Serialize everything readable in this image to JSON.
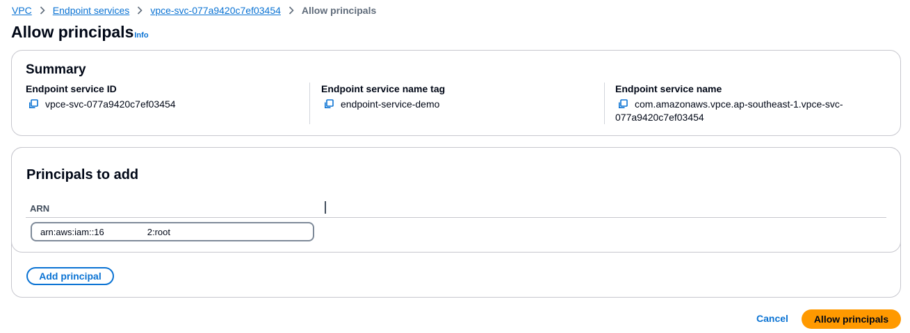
{
  "breadcrumb": {
    "items": [
      "VPC",
      "Endpoint services",
      "vpce-svc-077a9420c7ef03454"
    ],
    "current": "Allow principals"
  },
  "page": {
    "title": "Allow principals",
    "info_label": "Info"
  },
  "summary": {
    "title": "Summary",
    "columns": [
      {
        "label": "Endpoint service ID",
        "value": "vpce-svc-077a9420c7ef03454"
      },
      {
        "label": "Endpoint service name tag",
        "value": "endpoint-service-demo"
      },
      {
        "label": "Endpoint service name",
        "value_line1": "com.amazonaws.vpce.ap-southeast-1.vpce-svc-",
        "value_line2": "077a9420c7ef03454"
      }
    ]
  },
  "principals": {
    "title": "Principals to add",
    "column_header": "ARN",
    "arn_value": "arn:aws:iam::16",
    "arn_suffix": "2:root",
    "add_button_label": "Add principal"
  },
  "footer": {
    "cancel_label": "Cancel",
    "submit_label": "Allow principals"
  },
  "colors": {
    "link": "#0972d3",
    "primary_button": "#ff9900",
    "border": "#c6c6cd",
    "text": "#000716"
  },
  "icons": {
    "breadcrumb_separator": "chevron-right-icon",
    "copy": "copy-icon"
  }
}
